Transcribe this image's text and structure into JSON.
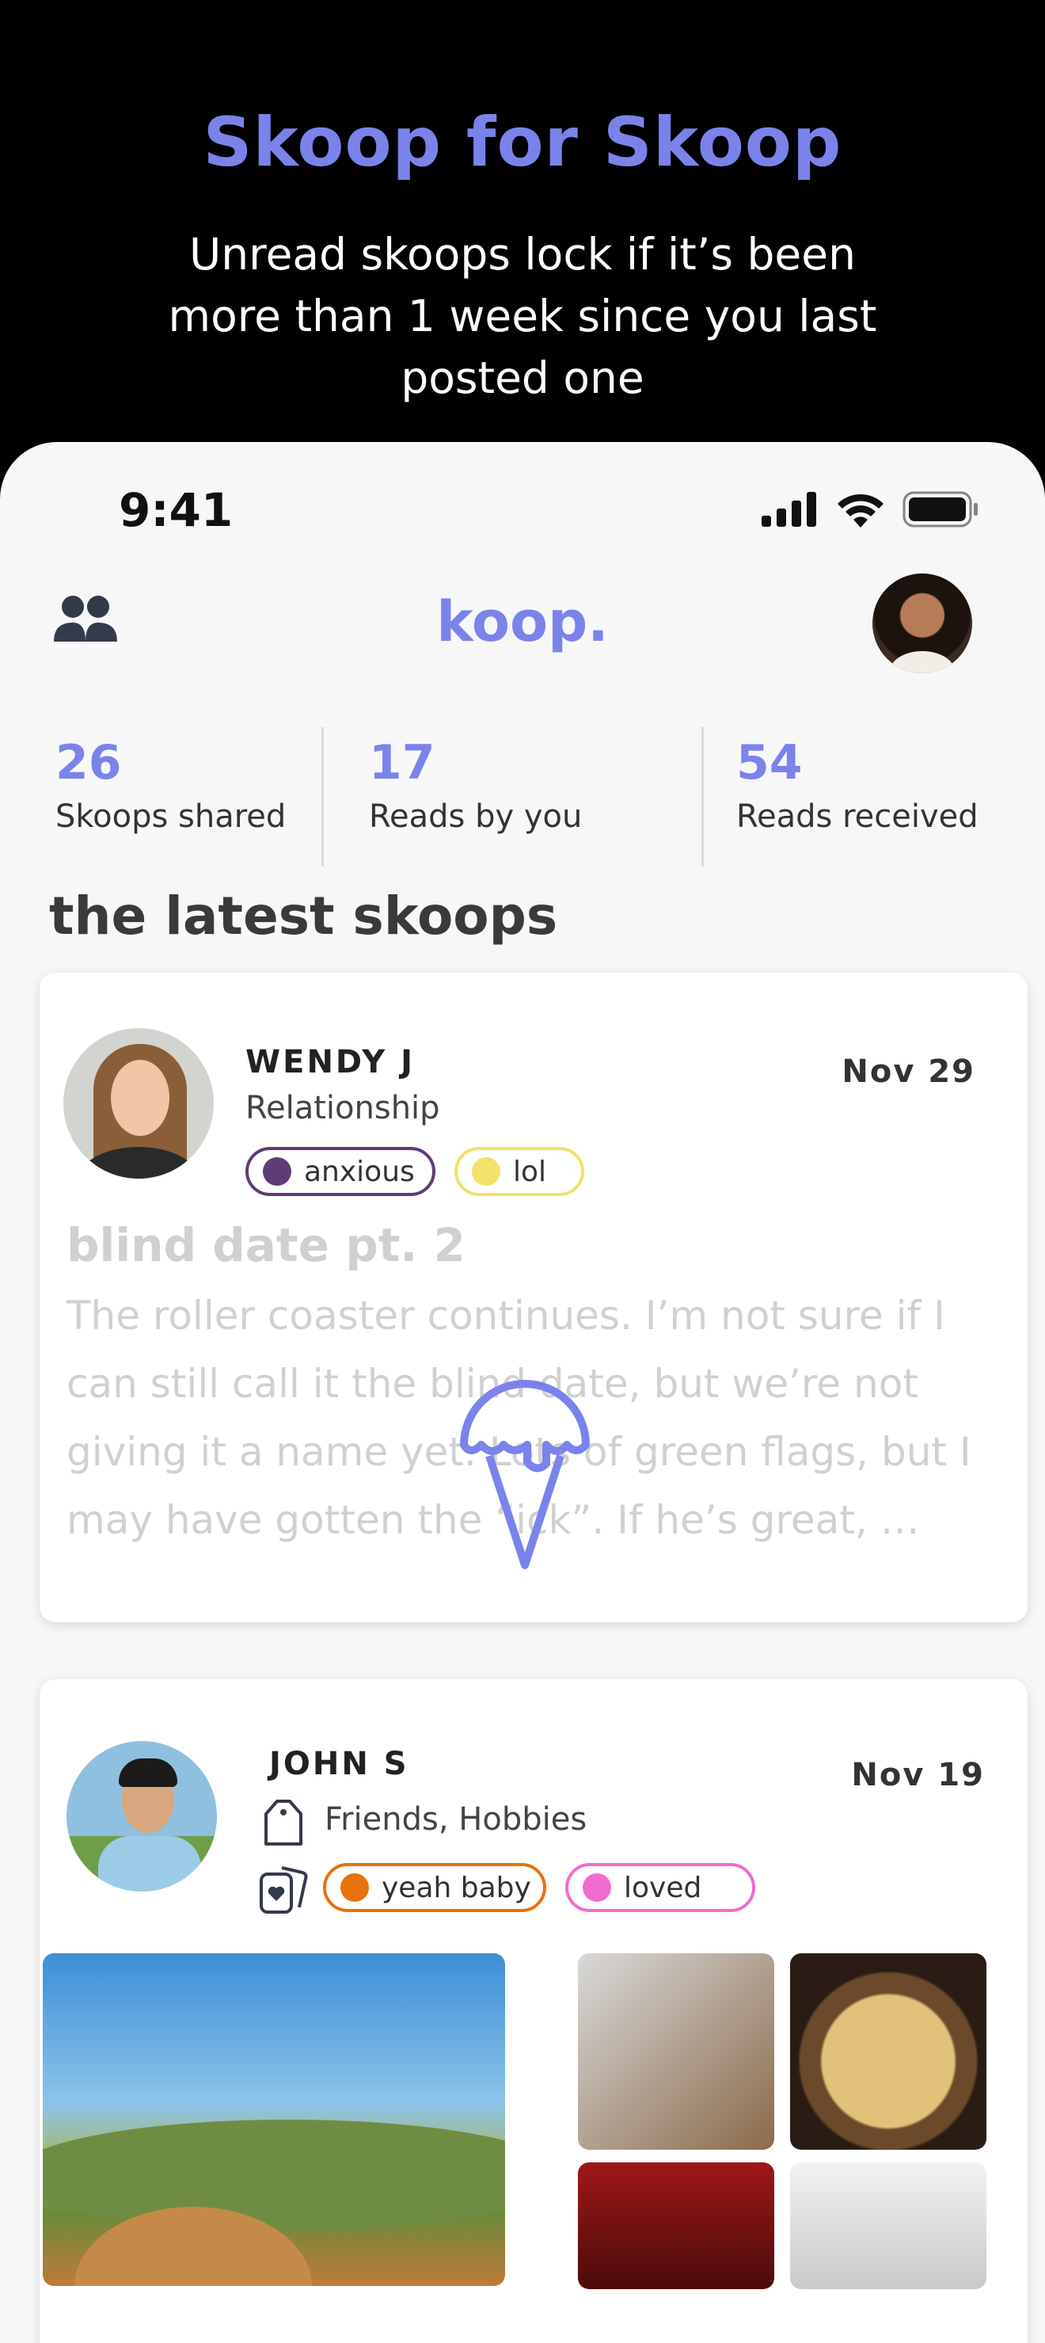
{
  "promo": {
    "title": "Skoop for Skoop",
    "subtitle": "Unread skoops lock if it’s been more than 1 week since you last posted one"
  },
  "status_bar": {
    "time": "9:41"
  },
  "header": {
    "logo": "koop."
  },
  "stats": [
    {
      "value": "26",
      "label": "Skoops shared"
    },
    {
      "value": "17",
      "label": "Reads by you"
    },
    {
      "value": "54",
      "label": "Reads received"
    }
  ],
  "section_title": "the latest skoops",
  "posts": [
    {
      "author": "WENDY J",
      "topic": "Relationship",
      "date": "Nov 29",
      "tags": [
        {
          "label": "anxious",
          "color": "#5e3c74"
        },
        {
          "label": "lol",
          "color": "#f0e26a"
        }
      ],
      "title": "blind date pt. 2",
      "body": "The roller coaster continues. I’m not sure if I can still call it the blind date, but we’re not giving it a name yet. Lots of green flags, but I may have gotten the “ick”. If he’s great, …"
    },
    {
      "author": "JOHN S",
      "topic": "Friends, Hobbies",
      "date": "Nov 19",
      "tags": [
        {
          "label": "yeah baby",
          "color": "#e8720c"
        },
        {
          "label": "loved",
          "color": "#f06ccf"
        }
      ]
    }
  ],
  "colors": {
    "accent": "#7b83eb",
    "locked_text": "#d0d0d0"
  }
}
